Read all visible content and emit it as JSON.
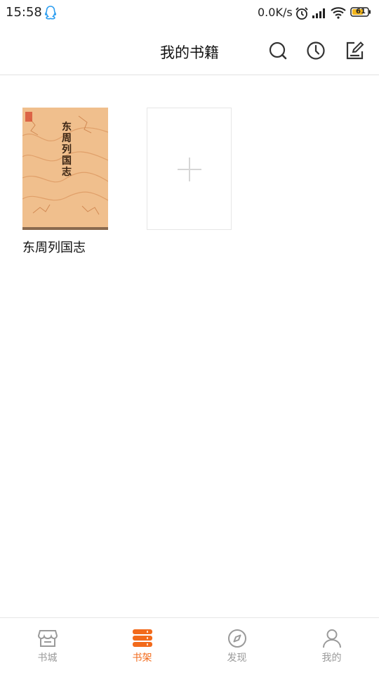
{
  "status_bar": {
    "time": "15:58",
    "net_speed": "0.0K/s",
    "battery": "61"
  },
  "header": {
    "title": "我的书籍"
  },
  "shelf": {
    "books": [
      {
        "title": "东周列国志",
        "cover_title": "东周列国志"
      }
    ]
  },
  "bottom_nav": {
    "items": [
      {
        "label": "书城",
        "icon": "store-icon"
      },
      {
        "label": "书架",
        "icon": "bookshelf-icon",
        "active": true
      },
      {
        "label": "发现",
        "icon": "compass-icon"
      },
      {
        "label": "我的",
        "icon": "profile-icon"
      }
    ]
  },
  "colors": {
    "accent": "#f26a1b",
    "inactive": "#9a9a9a",
    "cover": "#f0bf8d"
  }
}
